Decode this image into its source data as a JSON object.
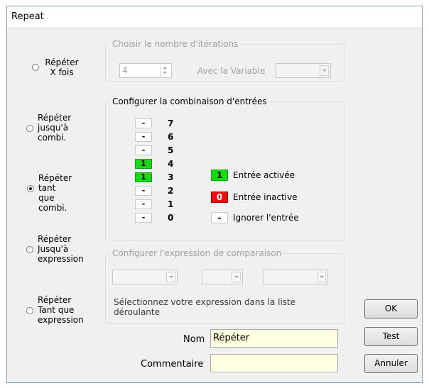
{
  "window": {
    "title": "Repeat"
  },
  "modes": [
    {
      "line1": "Répéter",
      "line2": "X fois",
      "line3": "",
      "checked": false
    },
    {
      "line1": "Répéter",
      "line2": "jusqu'à",
      "line3": "combi.",
      "checked": false
    },
    {
      "line1": "Répéter",
      "line2": "tant que",
      "line3": "combi.",
      "checked": true
    },
    {
      "line1": "Répéter",
      "line2": "Jusqu'à",
      "line3": "expression",
      "checked": false
    },
    {
      "line1": "Répéter",
      "line2": "Tant que",
      "line3": "expression",
      "checked": false
    }
  ],
  "iterations": {
    "legend": "Choisir le nombre d'itérations",
    "count_value": "4",
    "variable_label": "Avec la Variable",
    "variable_value": ""
  },
  "combination": {
    "legend": "Configurer la combinaison d'entrées",
    "bits": [
      {
        "num": "7",
        "value": "-"
      },
      {
        "num": "6",
        "value": "-"
      },
      {
        "num": "5",
        "value": "-"
      },
      {
        "num": "4",
        "value": "1"
      },
      {
        "num": "3",
        "value": "1"
      },
      {
        "num": "2",
        "value": "-"
      },
      {
        "num": "1",
        "value": "-"
      },
      {
        "num": "0",
        "value": "-"
      }
    ],
    "legend_items": [
      {
        "symbol": "1",
        "label": "Entrée activée",
        "color": "#18d818"
      },
      {
        "symbol": "0",
        "label": "Entrée inactive",
        "color": "#e81010"
      },
      {
        "symbol": "-",
        "label": "Ignorer l'entrée",
        "color": "#ffffff"
      }
    ]
  },
  "expression": {
    "legend": "Configurer l'expression de comparaison",
    "help_line1": "Sélectionnez votre expression dans la liste",
    "help_line2": "déroulante"
  },
  "form": {
    "name_label": "Nom",
    "name_value": "Répéter",
    "comment_label": "Commentaire",
    "comment_value": ""
  },
  "buttons": {
    "ok": "OK",
    "test": "Test",
    "cancel": "Annuler"
  }
}
